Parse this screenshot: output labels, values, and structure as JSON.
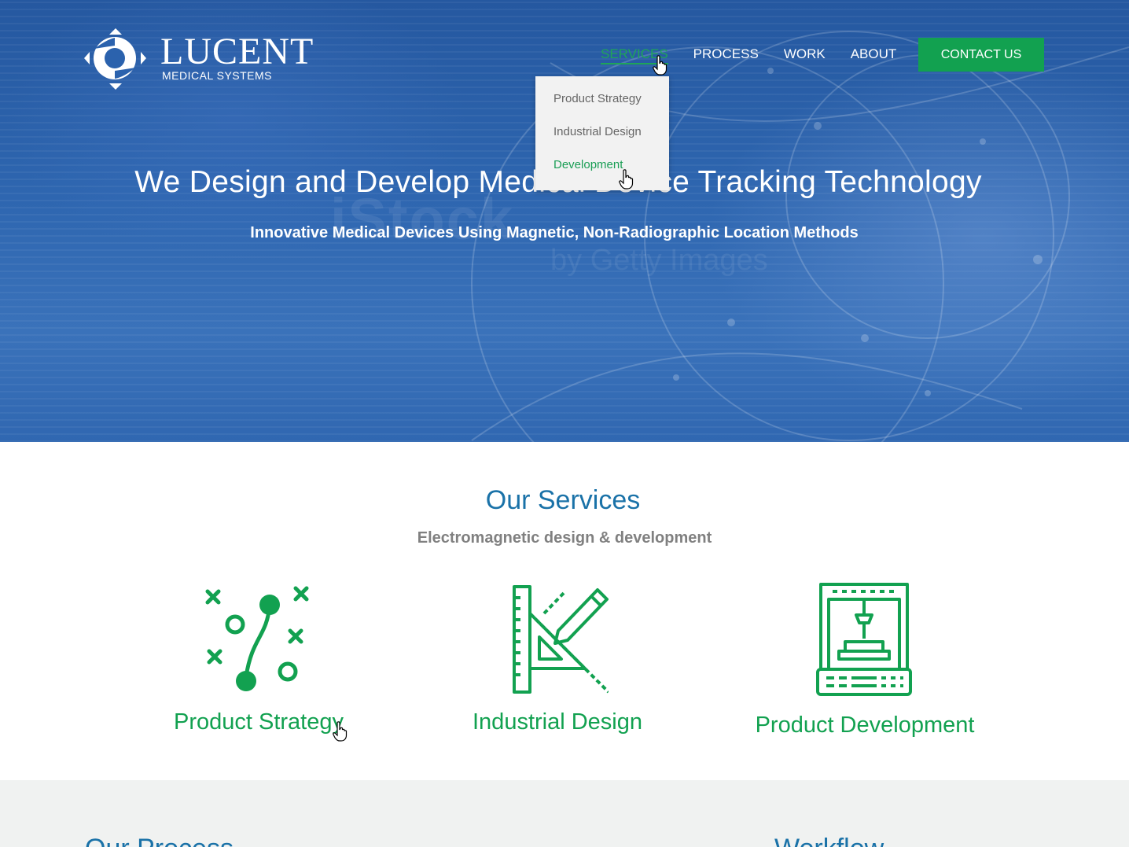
{
  "brand": {
    "name": "LUCENT",
    "tagline": "MEDICAL SYSTEMS",
    "logo_icon": "lucent-diamond-logo-icon"
  },
  "nav": {
    "items": [
      {
        "label": "SERVICES",
        "active": true
      },
      {
        "label": "PROCESS",
        "active": false
      },
      {
        "label": "WORK",
        "active": false
      },
      {
        "label": "ABOUT",
        "active": false
      }
    ],
    "contact_label": "CONTACT US"
  },
  "services_dropdown": {
    "items": [
      {
        "label": "Product Strategy",
        "hover": false
      },
      {
        "label": "Industrial Design",
        "hover": false
      },
      {
        "label": "Development",
        "hover": true
      }
    ]
  },
  "hero": {
    "title": "We Design and Develop Medical Device Tracking Technology",
    "subtitle": "Innovative Medical Devices Using Magnetic, Non-Radiographic Location Methods",
    "watermark": "iStock",
    "watermark_sub": "by Getty Images"
  },
  "services": {
    "title": "Our Services",
    "subtitle": "Electromagnetic design & development",
    "items": [
      {
        "label": "Product Strategy",
        "icon": "strategy-play-icon"
      },
      {
        "label": "Industrial Design",
        "icon": "ruler-pencil-icon"
      },
      {
        "label": "Product Development",
        "icon": "3d-printer-icon"
      }
    ]
  },
  "process": {
    "title": "Our Process",
    "workflow_title": "Workflow"
  },
  "colors": {
    "brand_green": "#12a150",
    "heading_blue": "#1a72a8",
    "hero_blue": "#2e66b0",
    "muted_gray": "#808080"
  }
}
